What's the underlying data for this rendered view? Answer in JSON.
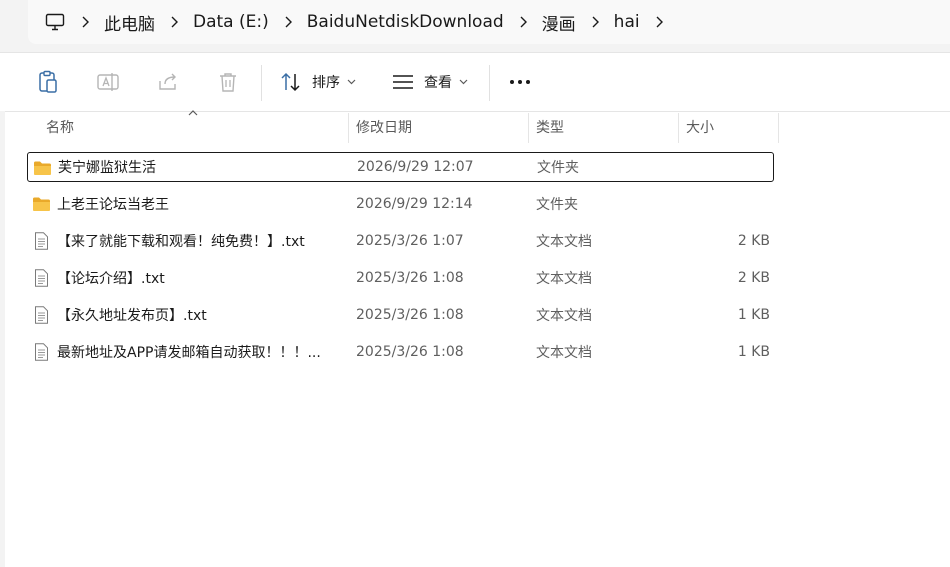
{
  "address": {
    "crumbs": [
      "此电脑",
      "Data (E:)",
      "BaiduNetdiskDownload",
      "漫画",
      "hai"
    ]
  },
  "toolbar": {
    "sort_label": "排序",
    "view_label": "查看"
  },
  "columns": {
    "name": "名称",
    "modified": "修改日期",
    "type": "类型",
    "size": "大小"
  },
  "files": [
    {
      "name": "芙宁娜监狱生活",
      "modified": "2026/9/29 12:07",
      "type": "文件夹",
      "size": "",
      "icon": "folder-icon",
      "selected": true
    },
    {
      "name": "上老王论坛当老王",
      "modified": "2026/9/29 12:14",
      "type": "文件夹",
      "size": "",
      "icon": "folder-icon",
      "selected": false
    },
    {
      "name": "【来了就能下载和观看！纯免费！】.txt",
      "modified": "2025/3/26 1:07",
      "type": "文本文档",
      "size": "2 KB",
      "icon": "text-file-icon",
      "selected": false
    },
    {
      "name": "【论坛介绍】.txt",
      "modified": "2025/3/26 1:08",
      "type": "文本文档",
      "size": "2 KB",
      "icon": "text-file-icon",
      "selected": false
    },
    {
      "name": "【永久地址发布页】.txt",
      "modified": "2025/3/26 1:08",
      "type": "文本文档",
      "size": "1 KB",
      "icon": "text-file-icon",
      "selected": false
    },
    {
      "name": "最新地址及APP请发邮箱自动获取！！！...",
      "modified": "2025/3/26 1:08",
      "type": "文本文档",
      "size": "1 KB",
      "icon": "text-file-icon",
      "selected": false
    }
  ],
  "colors": {
    "folder": "#f7c449",
    "folder_dark": "#e9a92a",
    "toolbar_icon": "#3a6ea5",
    "disabled_icon": "#b5b5b5",
    "selection_border": "#1a1a1a"
  }
}
